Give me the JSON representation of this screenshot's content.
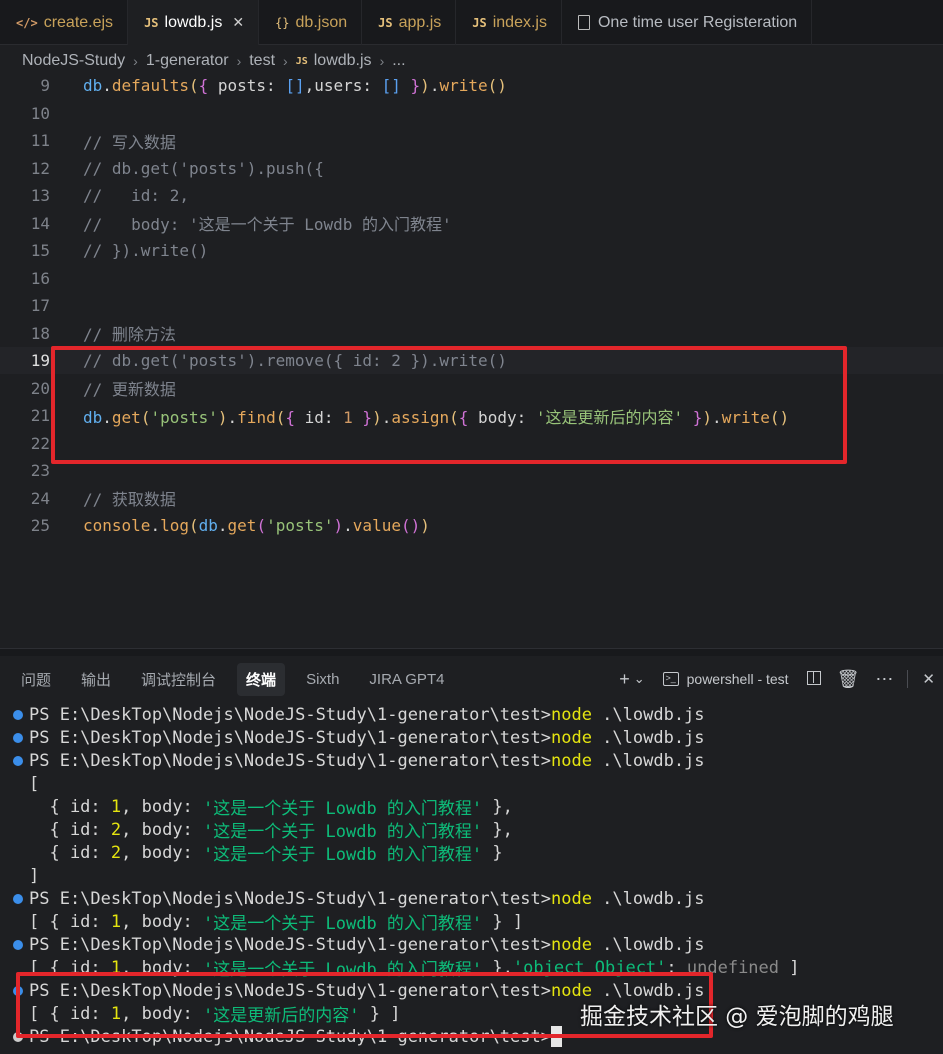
{
  "tabs": [
    {
      "icon": "</>",
      "name": "create.ejs",
      "kind": "ejs",
      "active": false
    },
    {
      "icon": "JS",
      "name": "lowdb.js",
      "kind": "js",
      "active": true,
      "close": "✕"
    },
    {
      "icon": "{}",
      "name": "db.json",
      "kind": "json",
      "active": false
    },
    {
      "icon": "JS",
      "name": "app.js",
      "kind": "js",
      "active": false
    },
    {
      "icon": "JS",
      "name": "index.js",
      "kind": "js",
      "active": false
    },
    {
      "icon": "doc",
      "name": "One time user Registeration",
      "kind": "doc",
      "active": false
    }
  ],
  "breadcrumb": {
    "parts": [
      "NodeJS-Study",
      "1-generator",
      "test"
    ],
    "file_badge": "JS",
    "file": "lowdb.js",
    "tail": "..."
  },
  "editor": {
    "lines": [
      {
        "n": "9",
        "current": false
      },
      {
        "n": "10",
        "current": false
      },
      {
        "n": "11",
        "current": false
      },
      {
        "n": "12",
        "current": false
      },
      {
        "n": "13",
        "current": false
      },
      {
        "n": "14",
        "current": false
      },
      {
        "n": "15",
        "current": false
      },
      {
        "n": "16",
        "current": false
      },
      {
        "n": "17",
        "current": false
      },
      {
        "n": "18",
        "current": false
      },
      {
        "n": "19",
        "current": true
      },
      {
        "n": "20",
        "current": false
      },
      {
        "n": "21",
        "current": false
      },
      {
        "n": "22",
        "current": false
      },
      {
        "n": "23",
        "current": false
      },
      {
        "n": "24",
        "current": false
      },
      {
        "n": "25",
        "current": false
      }
    ],
    "code": {
      "l9": {
        "obj": "db",
        "dot": ".",
        "fn": "defaults",
        "p1": "(",
        "p2": "{",
        "k1": " posts: ",
        "b1": "[]",
        "c1": ",users: ",
        "b2": "[]",
        "p2c": " }",
        "p1c": ")",
        "dot2": ".",
        "fn2": "write",
        "p3": "()"
      },
      "l11": "// 写入数据",
      "l12": "// db.get('posts').push({",
      "l13": "//   id: 2,",
      "l14": "//   body: '这是一个关于 Lowdb 的入门教程'",
      "l15": "// }).write()",
      "l18": "// 删除方法",
      "l19": "// db.get('posts').remove({ id: 2 }).write()",
      "l20": "// 更新数据",
      "l21": {
        "obj": "db",
        "dot": ".",
        "fn": "get",
        "p1": "(",
        "s1": "'posts'",
        "p1c": ")",
        "dot2": ".",
        "fn2": "find",
        "p2": "(",
        "b1": "{",
        "k1": " id: ",
        "num": "1",
        "b1c": " }",
        "p2c": ")",
        "dot3": ".",
        "fn3": "assign",
        "p3": "(",
        "b2": "{",
        "k2": " body: ",
        "s2": "'这是更新后的内容'",
        "b2c": " }",
        "p3c": ")",
        "dot4": ".",
        "fn4": "write",
        "p4": "()"
      },
      "l24": "// 获取数据",
      "l25": {
        "fn": "console",
        "dot": ".",
        "fn2": "log",
        "p1": "(",
        "obj": "db",
        "dot2": ".",
        "fn3": "get",
        "p2": "(",
        "s1": "'posts'",
        "p2c": ")",
        "dot3": ".",
        "fn4": "value",
        "p3": "()",
        "p1c": ")"
      }
    }
  },
  "panel": {
    "tabs": [
      "问题",
      "输出",
      "调试控制台",
      "终端",
      "Sixth",
      "JIRA GPT4"
    ],
    "active_tab": "终端",
    "actions": {
      "add": "+",
      "dropdown": "⌄",
      "shell_label": "powershell - test",
      "more": "⋯",
      "close": "✕"
    }
  },
  "terminal": {
    "prompt": "PS E:\\DeskTop\\Nodejs\\NodeJS-Study\\1-generator\\test>",
    "cmd": "node",
    "arg": " .\\lowdb.js",
    "open_bracket": "[",
    "close_bracket": "]",
    "row_prefix": "  { id: ",
    "row_mid": ", body: ",
    "row_end_comma": " },",
    "row_end": " }",
    "id1": "1",
    "id2": "2",
    "str_intro": "'这是一个关于 Lowdb 的入门教程'",
    "str_updated": "'这是更新后的内容'",
    "single_prefix": "[ { id: ",
    "single_end": " } ]",
    "obj_str": "'object Object'",
    "undef": " undefined",
    "tail_close": " ]"
  },
  "watermark": "掘金技术社区 @ 爱泡脚的鸡腿"
}
